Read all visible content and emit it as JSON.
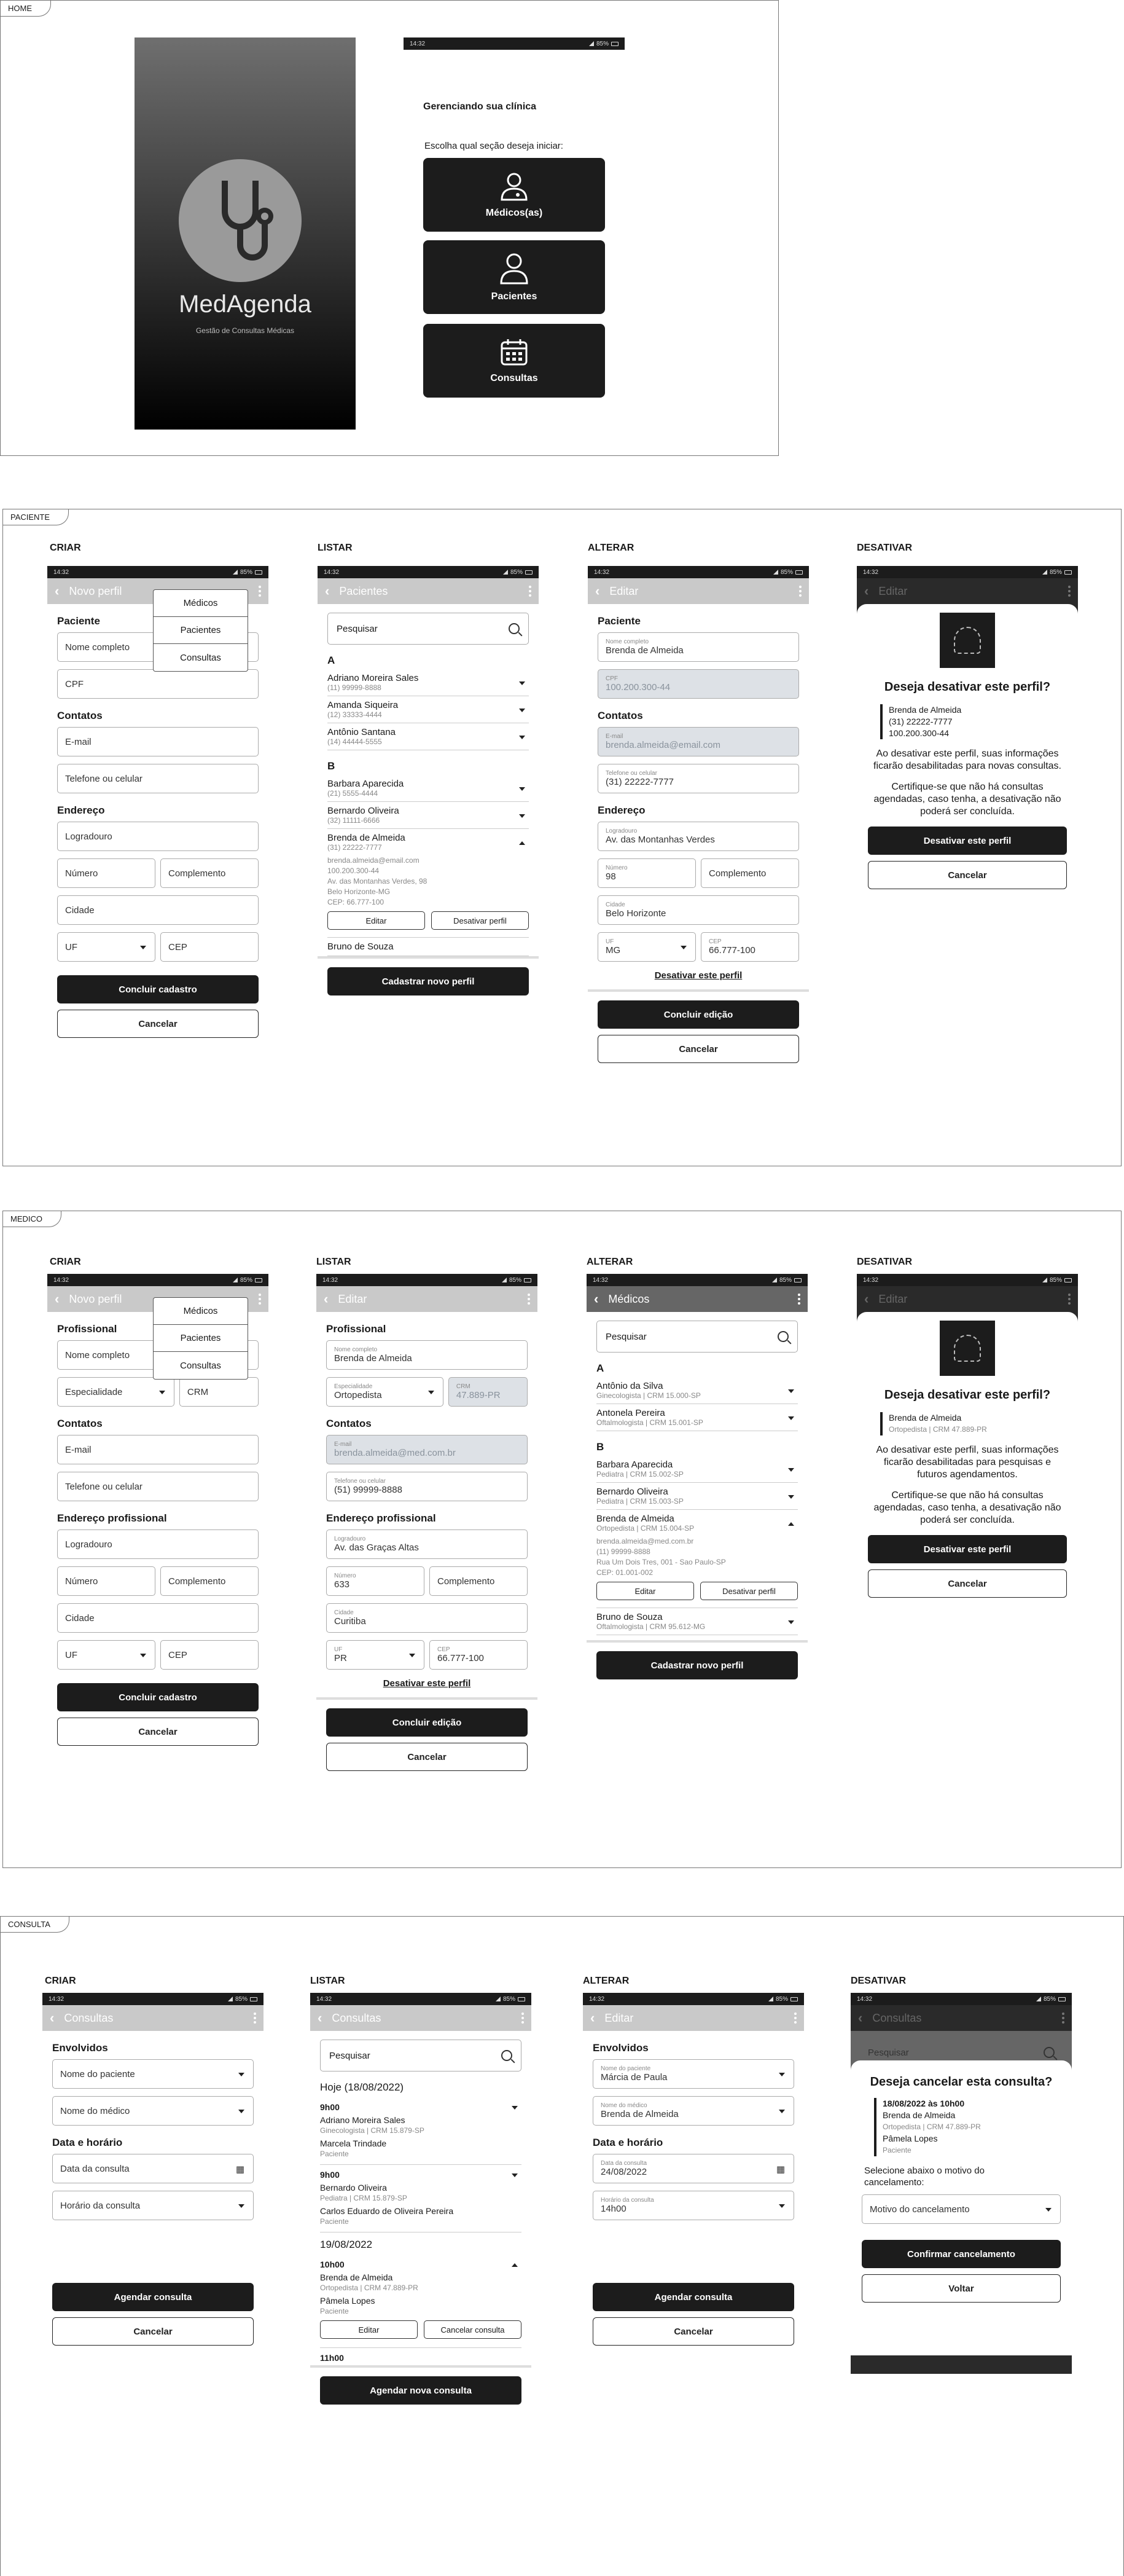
{
  "status": {
    "time": "14:32",
    "battery": "85%"
  },
  "home": {
    "tag": "HOME",
    "brand": "MedAgenda",
    "brand_sub": "Gestão de Consultas Médicas",
    "heading": "Gerenciando sua clínica",
    "prompt": "Escolha qual seção deseja iniciar:",
    "tiles": [
      "Médicos(as)",
      "Pacientes",
      "Consultas"
    ]
  },
  "paciente": {
    "tag": "PACIENTE",
    "cols": [
      "CRIAR",
      "LISTAR",
      "ALTERAR",
      "DESATIVAR"
    ],
    "criar": {
      "title": "Novo perfil",
      "menu": [
        "Médicos",
        "Pacientes",
        "Consultas"
      ],
      "sec1": "Paciente",
      "nome": "Nome completo",
      "cpf": "CPF",
      "sec2": "Contatos",
      "email": "E-mail",
      "tel": "Telefone ou celular",
      "sec3": "Endereço",
      "log": "Logradouro",
      "num": "Número",
      "comp": "Complemento",
      "cid": "Cidade",
      "uf": "UF",
      "cep": "CEP",
      "ok": "Concluir cadastro",
      "cancel": "Cancelar"
    },
    "listar": {
      "title": "Pacientes",
      "search": "Pesquisar",
      "groupA": "A",
      "itemsA": [
        {
          "n": "Adriano Moreira Sales",
          "s": "(11) 99999-8888"
        },
        {
          "n": "Amanda Siqueira",
          "s": "(12) 33333-4444"
        },
        {
          "n": "Antônio Santana",
          "s": "(14) 44444-5555"
        }
      ],
      "groupB": "B",
      "itemsB": [
        {
          "n": "Barbara Aparecida",
          "s": "(21) 5555-4444"
        },
        {
          "n": "Bernardo Oliveira",
          "s": "(32) 11111-6666"
        }
      ],
      "open": {
        "n": "Brenda de Almeida",
        "s": "(31) 22222-7777",
        "d1": "brenda.almeida@email.com",
        "d2": "100.200.300-44",
        "d3": "Av. das Montanhas Verdes, 98",
        "d4": "Belo Horizonte-MG",
        "d5": "CEP: 66.777-100"
      },
      "edit": "Editar",
      "deact": "Desativar perfil",
      "last": "Bruno de Souza",
      "new": "Cadastrar novo perfil"
    },
    "alterar": {
      "title": "Editar",
      "sec1": "Paciente",
      "nome_l": "Nome completo",
      "nome": "Brenda de Almeida",
      "cpf_l": "CPF",
      "cpf": "100.200.300-44",
      "sec2": "Contatos",
      "email_l": "E-mail",
      "email": "brenda.almeida@email.com",
      "tel_l": "Telefone ou celular",
      "tel": "(31) 22222-7777",
      "sec3": "Endereço",
      "log_l": "Logradouro",
      "log": "Av. das Montanhas Verdes",
      "num_l": "Número",
      "num": "98",
      "comp": "Complemento",
      "cid_l": "Cidade",
      "cid": "Belo Horizonte",
      "uf_l": "UF",
      "uf": "MG",
      "cep_l": "CEP",
      "cep": "66.777-100",
      "link": "Desativar este perfil",
      "ok": "Concluir edição",
      "cancel": "Cancelar"
    },
    "desativar": {
      "title": "Editar",
      "q": "Deseja desativar este perfil?",
      "l1": "Brenda de Almeida",
      "l2": "(31) 22222-7777",
      "l3": "100.200.300-44",
      "p1": "Ao desativar este perfil, suas informações ficarão desabilitadas para novas consultas.",
      "p2": "Certifique-se que não há consultas agendadas, caso tenha, a desativação não poderá ser concluída.",
      "ok": "Desativar este perfil",
      "cancel": "Cancelar"
    }
  },
  "medico": {
    "tag": "MEDICO",
    "cols": [
      "CRIAR",
      "LISTAR",
      "ALTERAR",
      "DESATIVAR"
    ],
    "criar": {
      "title": "Novo perfil",
      "menu": [
        "Médicos",
        "Pacientes",
        "Consultas"
      ],
      "sec1": "Profissional",
      "nome": "Nome completo",
      "esp": "Especialidade",
      "crm": "CRM",
      "sec2": "Contatos",
      "email": "E-mail",
      "tel": "Telefone ou celular",
      "sec3": "Endereço profissional",
      "log": "Logradouro",
      "num": "Número",
      "comp": "Complemento",
      "cid": "Cidade",
      "uf": "UF",
      "cep": "CEP",
      "ok": "Concluir cadastro",
      "cancel": "Cancelar"
    },
    "listar": {
      "title": "Editar",
      "sec1": "Profissional",
      "nome_l": "Nome completo",
      "nome": "Brenda de Almeida",
      "esp_l": "Especialidade",
      "esp": "Ortopedista",
      "crm_l": "CRM",
      "crm": "47.889-PR",
      "sec2": "Contatos",
      "email_l": "E-mail",
      "email": "brenda.almeida@med.com.br",
      "tel_l": "Telefone ou celular",
      "tel": "(51) 99999-8888",
      "sec3": "Endereço profissional",
      "log_l": "Logradouro",
      "log": "Av. das Graças Altas",
      "num_l": "Número",
      "num": "633",
      "comp": "Complemento",
      "cid_l": "Cidade",
      "cid": "Curitiba",
      "uf_l": "UF",
      "uf": "PR",
      "cep_l": "CEP",
      "cep": "66.777-100",
      "link": "Desativar este perfil",
      "ok": "Concluir edição",
      "cancel": "Cancelar"
    },
    "alterar": {
      "title": "Médicos",
      "search": "Pesquisar",
      "groupA": "A",
      "itemsA": [
        {
          "n": "Antônio da Silva",
          "s": "Ginecologista | CRM 15.000-SP"
        },
        {
          "n": "Antonela Pereira",
          "s": "Oftalmologista | CRM 15.001-SP"
        }
      ],
      "groupB": "B",
      "itemsB": [
        {
          "n": "Barbara Aparecida",
          "s": "Pediatra | CRM 15.002-SP"
        },
        {
          "n": "Bernardo Oliveira",
          "s": "Pediatra | CRM 15.003-SP"
        }
      ],
      "open": {
        "n": "Brenda de Almeida",
        "s": "Ortopedista | CRM 15.004-SP",
        "d1": "brenda.almeida@med.com.br",
        "d2": "(11) 99999-8888",
        "d3": "Rua Um Dois Tres, 001 - Sao Paulo-SP",
        "d4": "CEP: 01.001-002"
      },
      "edit": "Editar",
      "deact": "Desativar perfil",
      "last": {
        "n": "Bruno de Souza",
        "s": "Oftalmologista | CRM 95.612-MG"
      },
      "new": "Cadastrar novo perfil"
    },
    "desativar": {
      "title": "Editar",
      "q": "Deseja desativar este perfil?",
      "l1": "Brenda de Almeida",
      "l2": "Ortopedista | CRM 47.889-PR",
      "p1": "Ao desativar este perfil, suas informações ficarão desabilitadas para pesquisas e futuros agendamentos.",
      "p2": "Certifique-se que não há consultas agendadas, caso tenha, a desativação não poderá ser concluída.",
      "ok": "Desativar este perfil",
      "cancel": "Cancelar"
    }
  },
  "consulta": {
    "tag": "CONSULTA",
    "cols": [
      "CRIAR",
      "LISTAR",
      "ALTERAR",
      "DESATIVAR"
    ],
    "criar": {
      "title": "Consultas",
      "sec1": "Envolvidos",
      "pac": "Nome do paciente",
      "med": "Nome do médico",
      "sec2": "Data e horário",
      "data": "Data da consulta",
      "hora": "Horário da consulta",
      "ok": "Agendar consulta",
      "cancel": "Cancelar"
    },
    "listar": {
      "title": "Consultas",
      "search": "Pesquisar",
      "day1": "Hoje (18/08/2022)",
      "a1": {
        "h": "9h00",
        "m": "Adriano Moreira Sales",
        "ms": "Ginecologista | CRM 15.879-SP",
        "p": "Marcela Trindade",
        "ps": "Paciente"
      },
      "a2": {
        "h": "9h00",
        "m": "Bernardo Oliveira",
        "ms": "Pediatra | CRM 15.879-SP",
        "p": "Carlos Eduardo de Oliveira Pereira",
        "ps": "Paciente"
      },
      "day2": "19/08/2022",
      "a3": {
        "h": "10h00",
        "m": "Brenda de Almeida",
        "ms": "Ortopedista | CRM 47.889-PR",
        "p": "Pâmela Lopes",
        "ps": "Paciente"
      },
      "edit": "Editar",
      "cancelc": "Cancelar consulta",
      "a4": "11h00",
      "new": "Agendar nova consulta"
    },
    "alterar": {
      "title": "Editar",
      "sec1": "Envolvidos",
      "pac_l": "Nome do paciente",
      "pac": "Márcia de Paula",
      "med_l": "Nome do médico",
      "med": "Brenda de Almeida",
      "sec2": "Data e horário",
      "data_l": "Data da consulta",
      "data": "24/08/2022",
      "hora_l": "Horário da consulta",
      "hora": "14h00",
      "ok": "Agendar consulta",
      "cancel": "Cancelar"
    },
    "desativar": {
      "title": "Consultas",
      "search": "Pesquisar",
      "q": "Deseja cancelar esta consulta?",
      "l1": "18/08/2022 às 10h00",
      "l2": "Brenda de Almeida",
      "l3": "Ortopedista | CRM 47.889-PR",
      "l4": "Pâmela Lopes",
      "l5": "Paciente",
      "prompt": "Selecione abaixo o motivo do cancelamento:",
      "motivo": "Motivo do cancelamento",
      "ok": "Confirmar cancelamento",
      "cancel": "Voltar"
    }
  }
}
